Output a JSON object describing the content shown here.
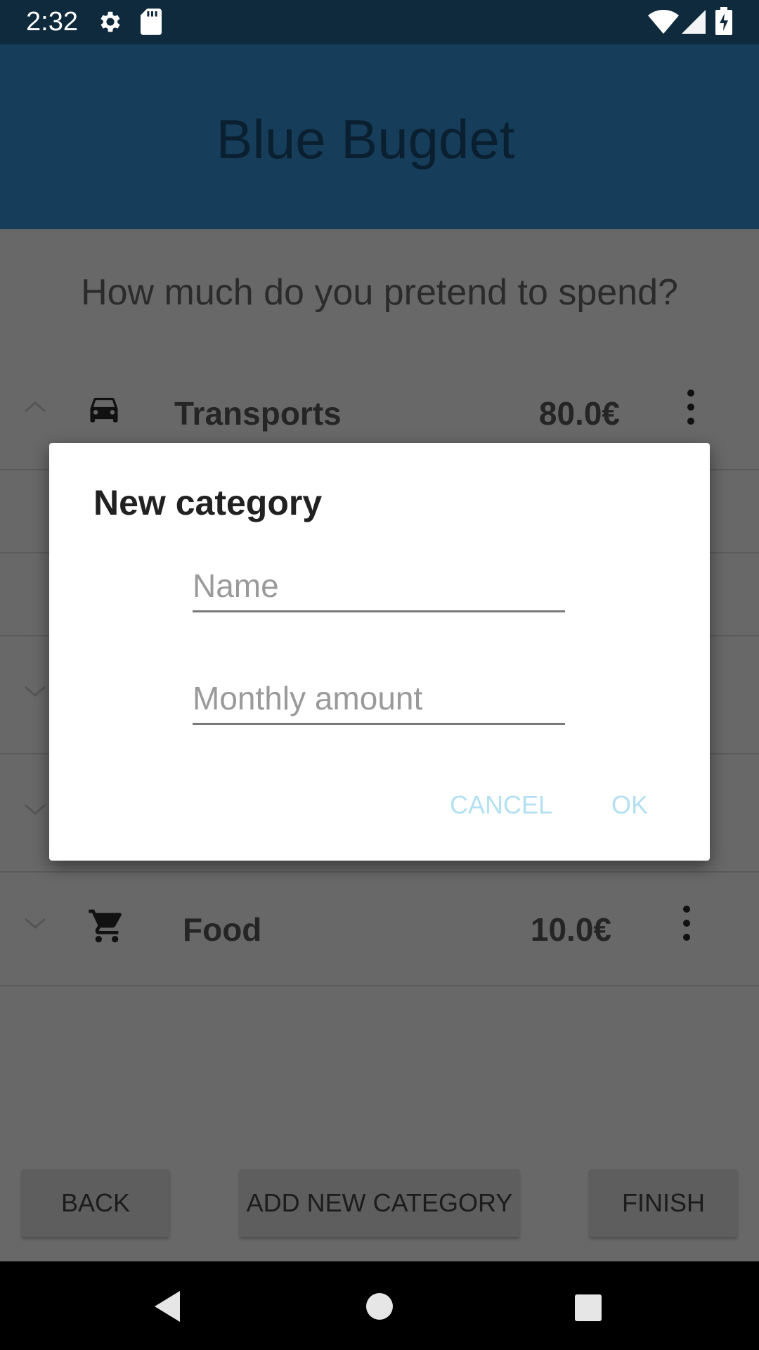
{
  "status_bar": {
    "time": "2:32",
    "icons": [
      "gear-icon",
      "sd-card-icon",
      "wifi-icon",
      "signal-icon",
      "battery-charging-icon"
    ]
  },
  "app_bar": {
    "title": "Blue Bugdet",
    "background": "#163d5a"
  },
  "main": {
    "question": "How much do you pretend to spend?",
    "categories": [
      {
        "name": "Transports",
        "amount": "80.0€",
        "icon": "car-icon",
        "expanded": true
      },
      {
        "name": "",
        "amount": "",
        "expanded": false
      },
      {
        "name": "",
        "amount": "",
        "expanded": false
      },
      {
        "name": "Food",
        "amount": "10.0€",
        "icon": "shopping-cart-icon",
        "expanded": false
      }
    ]
  },
  "bottom_buttons": {
    "back": "BACK",
    "add": "ADD NEW CATEGORY",
    "finish": "FINISH"
  },
  "dialog": {
    "title": "New category",
    "name_placeholder": "Name",
    "amount_placeholder": "Monthly amount",
    "cancel": "CANCEL",
    "ok": "OK",
    "button_color": "#b3e0f2"
  },
  "nav_bar": {
    "icons": [
      "back-nav-icon",
      "home-nav-icon",
      "recents-nav-icon"
    ]
  }
}
